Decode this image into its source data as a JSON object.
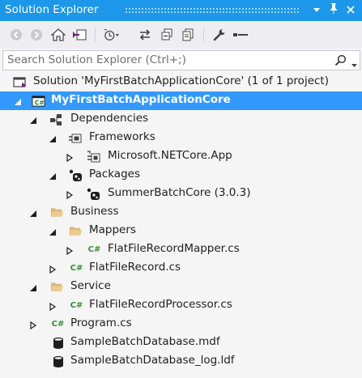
{
  "window": {
    "title": "Solution Explorer",
    "controls": {
      "dropdown": "▾",
      "pin": "📌",
      "close": "✕"
    }
  },
  "toolbar": {
    "tools": [
      "back-icon",
      "forward-icon",
      "home-icon",
      "switch-views-icon",
      "pending-changes-filter-icon",
      "sync-with-active-document-icon",
      "collapse-all-icon",
      "show-all-files-icon",
      "properties-icon",
      "preview-selected-items-icon"
    ]
  },
  "search": {
    "placeholder": "Search Solution Explorer (Ctrl+;)"
  },
  "tree": {
    "solution": "Solution 'MyFirstBatchApplicationCore' (1 of 1 project)",
    "project": "MyFirstBatchApplicationCore",
    "dependencies": "Dependencies",
    "frameworks": "Frameworks",
    "netcore": "Microsoft.NETCore.App",
    "packages": "Packages",
    "summerbatch": "SummerBatchCore (3.0.3)",
    "business": "Business",
    "mappers": "Mappers",
    "mapper_file": "FlatFileRecordMapper.cs",
    "record_file": "FlatFileRecord.cs",
    "service": "Service",
    "processor_file": "FlatFileRecordProcessor.cs",
    "program_file": "Program.cs",
    "mdf_file": "SampleBatchDatabase.mdf",
    "ldf_file": "SampleBatchDatabase_log.ldf",
    "cs_badge": "C#"
  },
  "colors": {
    "titlebar": "#1c97ea",
    "selection": "#3399ff",
    "folder": "#dcb67a",
    "csharp": "#388a34"
  }
}
